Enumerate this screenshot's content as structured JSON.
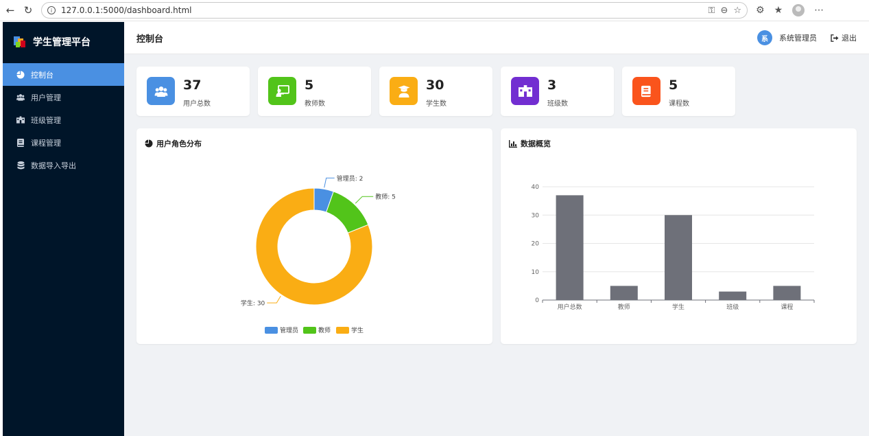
{
  "browser": {
    "url": "127.0.0.1:5000/dashboard.html"
  },
  "sidebar": {
    "brand": "学生管理平台",
    "items": [
      {
        "label": "控制台",
        "icon": "pie-chart-icon",
        "active": true
      },
      {
        "label": "用户管理",
        "icon": "users-icon",
        "active": false
      },
      {
        "label": "班级管理",
        "icon": "school-icon",
        "active": false
      },
      {
        "label": "课程管理",
        "icon": "book-icon",
        "active": false
      },
      {
        "label": "数据导入导出",
        "icon": "database-icon",
        "active": false
      }
    ]
  },
  "header": {
    "title": "控制台",
    "avatar_text": "系",
    "username": "系统管理员",
    "logout_label": "退出"
  },
  "stats": [
    {
      "value": "37",
      "label": "用户总数",
      "icon": "users-icon",
      "color": "#4a90e2"
    },
    {
      "value": "5",
      "label": "教师数",
      "icon": "chalkboard-teacher-icon",
      "color": "#52c41a"
    },
    {
      "value": "30",
      "label": "学生数",
      "icon": "graduate-icon",
      "color": "#faad14"
    },
    {
      "value": "3",
      "label": "班级数",
      "icon": "school-icon",
      "color": "#722ed1"
    },
    {
      "value": "5",
      "label": "课程数",
      "icon": "book-icon",
      "color": "#fa541c"
    }
  ],
  "panels": {
    "pie_title": "用户角色分布",
    "bar_title": "数据概览"
  },
  "chart_data": [
    {
      "type": "pie",
      "donut": true,
      "title": "用户角色分布",
      "categories": [
        "管理员",
        "教师",
        "学生"
      ],
      "values": [
        2,
        5,
        30
      ],
      "labels": [
        "管理员: 2",
        "教师: 5",
        "学生: 30"
      ],
      "colors": [
        "#4a90e2",
        "#52c41a",
        "#faad14"
      ],
      "legend": "bottom-center"
    },
    {
      "type": "bar",
      "title": "数据概览",
      "categories": [
        "用户总数",
        "教师",
        "学生",
        "班级",
        "课程"
      ],
      "values": [
        37,
        5,
        30,
        3,
        5
      ],
      "yticks": [
        "0",
        "10",
        "20",
        "30",
        "40"
      ],
      "ylim": [
        0,
        40
      ],
      "color": "#6e7079",
      "grid": true
    }
  ]
}
